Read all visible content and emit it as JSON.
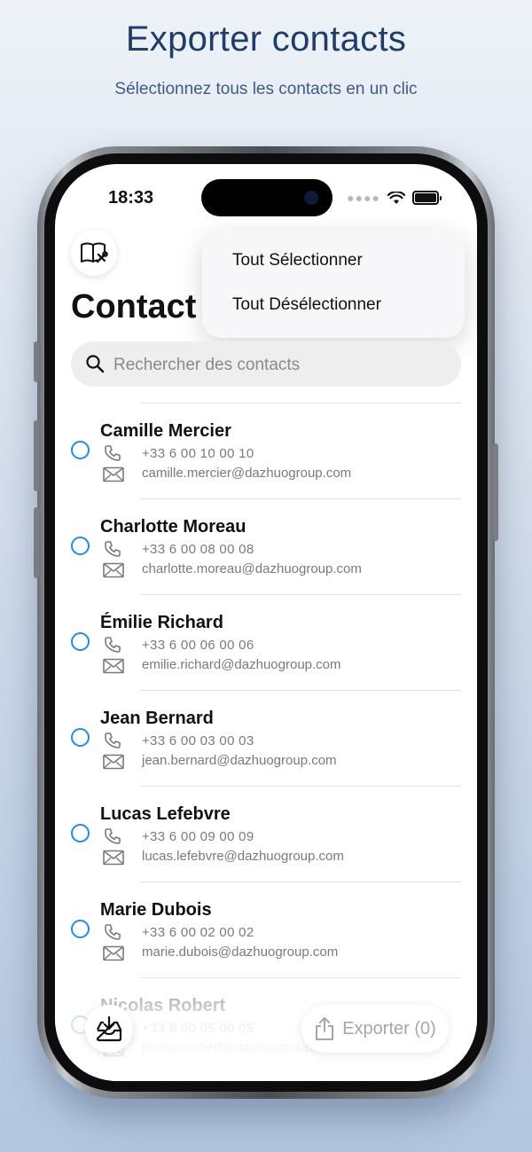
{
  "header": {
    "title": "Exporter contacts",
    "subtitle": "Sélectionnez tous les contacts en un clic"
  },
  "status_bar": {
    "time": "18:33"
  },
  "screen": {
    "title": "Contact",
    "menu": {
      "items": [
        "Tout Sélectionner",
        "Tout Désélectionner"
      ]
    },
    "search": {
      "placeholder": "Rechercher des contacts"
    },
    "contacts": [
      {
        "name": "Camille Mercier",
        "phone": "+33 6 00 10 00 10",
        "email": "camille.mercier@dazhuogroup.com"
      },
      {
        "name": "Charlotte Moreau",
        "phone": "+33 6 00 08 00 08",
        "email": "charlotte.moreau@dazhuogroup.com"
      },
      {
        "name": "Émilie Richard",
        "phone": "+33 6 00 06 00 06",
        "email": "emilie.richard@dazhuogroup.com"
      },
      {
        "name": "Jean Bernard",
        "phone": "+33 6 00 03 00 03",
        "email": "jean.bernard@dazhuogroup.com"
      },
      {
        "name": "Lucas Lefebvre",
        "phone": "+33 6 00 09 00 09",
        "email": "lucas.lefebvre@dazhuogroup.com"
      },
      {
        "name": "Marie Dubois",
        "phone": "+33 6 00 02 00 02",
        "email": "marie.dubois@dazhuogroup.com"
      },
      {
        "name": "Nicolas Robert",
        "phone": "+33 6 00 05 00 05",
        "email": "nicolas.robert@dazhuogroup.com"
      }
    ],
    "export_button": {
      "label": "Exporter (0)"
    }
  },
  "colors": {
    "accent": "#1d8cf0",
    "title_blue": "#1f3d6b",
    "secondary_text": "#7a7a7e"
  },
  "icons": [
    "book-tools-icon",
    "search-icon",
    "phone-icon",
    "mail-icon",
    "tray-import-icon",
    "share-export-icon",
    "wifi-icon",
    "battery-icon"
  ]
}
